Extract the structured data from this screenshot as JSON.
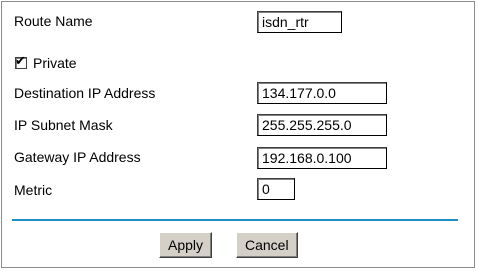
{
  "form": {
    "route_name_label": "Route Name",
    "route_name_value": "isdn_rtr",
    "private_label": "Private",
    "private_checked_glyph": "✔",
    "dest_ip_label": "Destination IP Address",
    "dest_ip_value": "134.177.0.0",
    "subnet_label": "IP Subnet Mask",
    "subnet_value": "255.255.255.0",
    "gateway_label": "Gateway IP Address",
    "gateway_value": "192.168.0.100",
    "metric_label": "Metric",
    "metric_value": "0"
  },
  "buttons": {
    "apply_label": "Apply",
    "cancel_label": "Cancel"
  },
  "colors": {
    "divider": "#1e90c8",
    "button_face": "#d4d0c8"
  }
}
